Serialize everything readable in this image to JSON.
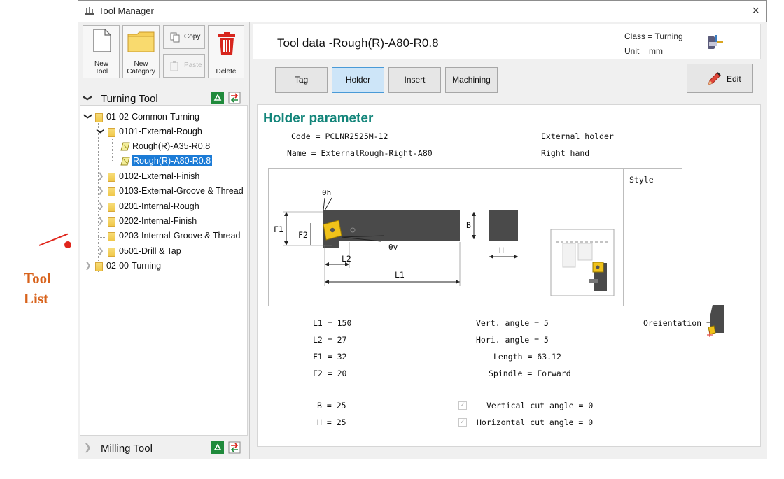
{
  "annotation": {
    "text_line1": "Tool",
    "text_line2": "List",
    "color": "#e0261c"
  },
  "window": {
    "title": "Tool Manager",
    "close_glyph": "×"
  },
  "toolbar": {
    "new_tool": "New Tool",
    "new_category_line1": "New",
    "new_category_line2": "Category",
    "copy": "Copy",
    "paste": "Paste",
    "delete": "Delete"
  },
  "turning_section": {
    "label": "Turning Tool"
  },
  "milling_section": {
    "label": "Milling Tool"
  },
  "tree": {
    "nodes": [
      {
        "label": "01-02-Common-Turning"
      },
      {
        "label": "0101-External-Rough"
      },
      {
        "label": "Rough(R)-A35-R0.8"
      },
      {
        "label": "Rough(R)-A80-R0.8"
      },
      {
        "label": "0102-External-Finish"
      },
      {
        "label": "0103-External-Groove & Thread"
      },
      {
        "label": "0201-Internal-Rough"
      },
      {
        "label": "0202-Internal-Finish"
      },
      {
        "label": "0203-Internal-Groove & Thread"
      },
      {
        "label": "0501-Drill & Tap"
      },
      {
        "label": "02-00-Turning"
      }
    ]
  },
  "header": {
    "title": "Tool data -Rough(R)-A80-R0.8",
    "class_text": "Class = Turning",
    "unit_text": "Unit = mm"
  },
  "tabs": [
    {
      "label": "Tag"
    },
    {
      "label": "Holder"
    },
    {
      "label": "Insert"
    },
    {
      "label": "Machining"
    }
  ],
  "edit_button": {
    "label": "Edit"
  },
  "panel": {
    "title": "Holder parameter",
    "code": "Code = PCLNR2525M-12",
    "name": "Name = ExternalRough-Right-A80",
    "holder_type": "External holder",
    "hand": "Right hand",
    "style_label": "Style",
    "orientation_label": "Oreientation =",
    "params_left": [
      "L1 = 150",
      "L2 = 27",
      "F1 = 32",
      "F2 = 20"
    ],
    "params_mid": [
      "Vert. angle = 5",
      "Hori. angle = 5",
      "Length = 63.12",
      "Spindle = Forward"
    ],
    "b_value": "B = 25",
    "h_value": "H = 25",
    "vertical_cut": "Vertical cut angle = 0",
    "horizontal_cut": "Horizontal cut angle = 0"
  },
  "diagram_labels": {
    "theta_h": "θh",
    "theta_v": "θv",
    "f1": "F1",
    "f2": "F2",
    "b": "B",
    "h": "H",
    "l1": "L1",
    "l2": "L2"
  }
}
